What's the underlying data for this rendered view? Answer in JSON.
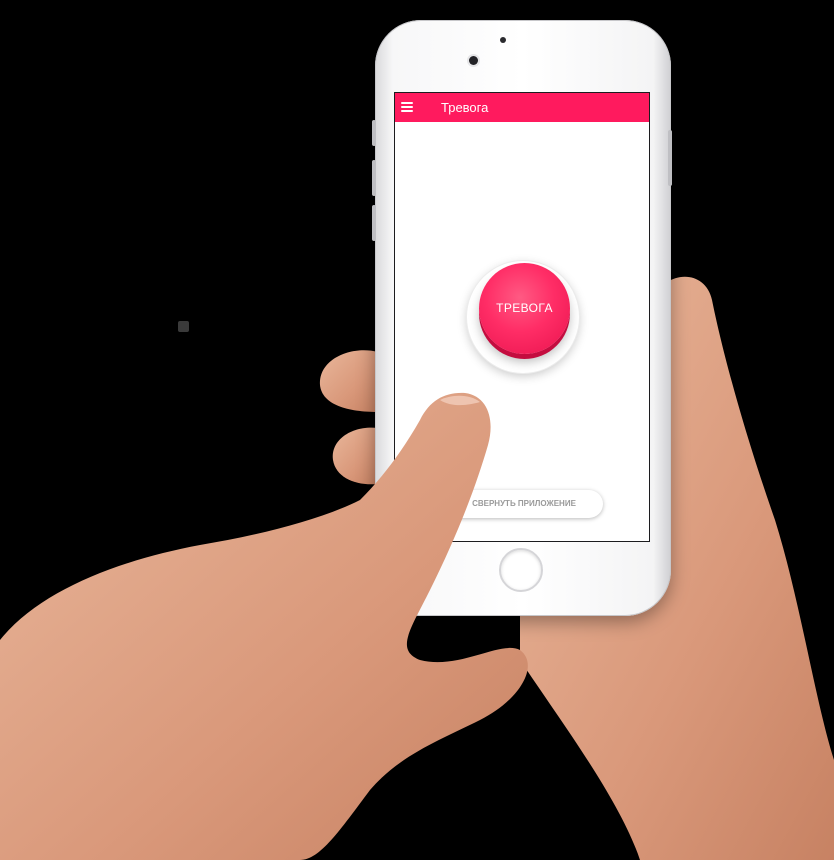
{
  "app": {
    "title": "Тревога",
    "menu_icon": "hamburger-menu-icon"
  },
  "alarm": {
    "label": "ТРЕВОГА"
  },
  "minimize": {
    "label": "СВЕРНУТЬ ПРИЛОЖЕНИЕ"
  },
  "colors": {
    "accent": "#ff1a5e",
    "alarm_button": "#ff2d66",
    "background": "#000000"
  }
}
